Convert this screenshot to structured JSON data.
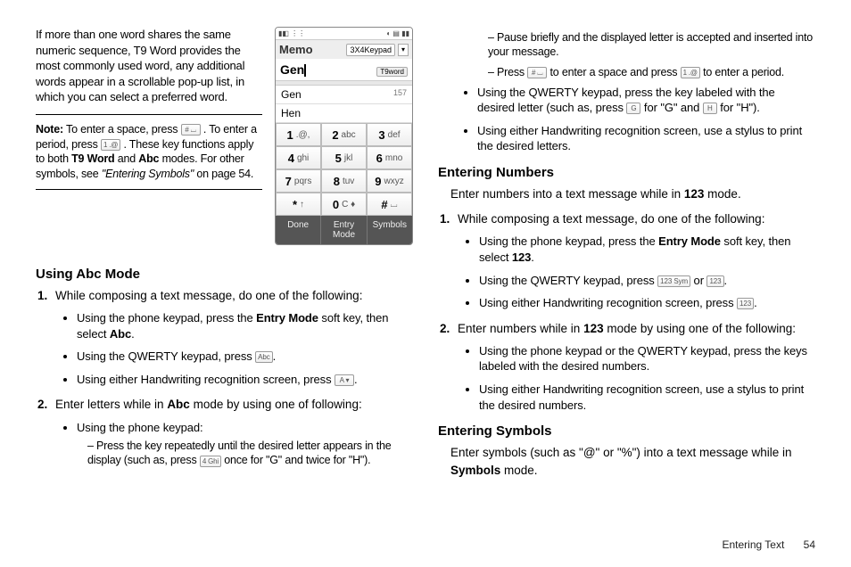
{
  "col1": {
    "intro": "If more than one word shares the same numeric sequence, T9 Word provides the most commonly used word, any additional words appear in a scrollable pop-up list, in which you can select a preferred word.",
    "note": {
      "label": "Note:",
      "p1a": "To enter a space, press ",
      "p1b": ". To enter a period, press ",
      "p1c": ". These key functions apply to both ",
      "b1": "T9 Word",
      "p1d": " and ",
      "b2": "Abc",
      "p1e": " modes. For other symbols, see ",
      "i1": "\"Entering Symbols\"",
      "p1f": " on page 54."
    },
    "h_abc": "Using Abc Mode",
    "abc_1": "While composing a text message, do one of the following:",
    "abc_1_b1a": "Using the phone keypad, press the ",
    "abc_1_b1b": "Entry Mode",
    "abc_1_b1c": " soft key, then select ",
    "abc_1_b1d": "Abc",
    "abc_1_b1e": ".",
    "abc_1_b2a": "Using the QWERTY keypad, press ",
    "abc_1_b2b": ".",
    "abc_1_b3a": "Using either Handwriting recognition screen, press ",
    "abc_1_b3b": ".",
    "abc_2a": "Enter letters while in ",
    "abc_2b": "Abc",
    "abc_2c": " mode by using one of following:",
    "abc_2_b1": "Using the phone keypad:",
    "abc_2_b1_d1a": "Press the key repeatedly until the desired letter appears in the display (such as, press ",
    "abc_2_b1_d1b": " once for \"G\" and twice for \"H\")."
  },
  "phone": {
    "title": "Memo",
    "mode_label": "3X4Keypad",
    "typed": "Gen",
    "badge": "T9word",
    "sugg1": "Gen",
    "sugg1_ct": "157",
    "sugg2": "Hen",
    "keys": [
      {
        "n": "1",
        "l": ".@,"
      },
      {
        "n": "2",
        "l": "abc"
      },
      {
        "n": "3",
        "l": "def"
      },
      {
        "n": "4",
        "l": "ghi"
      },
      {
        "n": "5",
        "l": "jkl"
      },
      {
        "n": "6",
        "l": "mno"
      },
      {
        "n": "7",
        "l": "pqrs"
      },
      {
        "n": "8",
        "l": "tuv"
      },
      {
        "n": "9",
        "l": "wxyz"
      },
      {
        "n": "*",
        "l": "↑"
      },
      {
        "n": "0",
        "l": "C ♦"
      },
      {
        "n": "#",
        "l": "⌴"
      }
    ],
    "sk1": "Done",
    "sk2": "Entry Mode",
    "sk3": "Symbols"
  },
  "col2": {
    "cont_d1": "Pause briefly and the displayed letter is accepted and inserted into your message.",
    "cont_d2a": "Press ",
    "cont_d2b": " to enter a space and press ",
    "cont_d2c": " to enter a period.",
    "cont_b2a": "Using the QWERTY keypad, press the key labeled with the desired letter (such as, press ",
    "cont_b2b": " for \"G\" and ",
    "cont_b2c": " for \"H\").",
    "cont_b3": "Using either Handwriting recognition screen, use a stylus to print the desired letters.",
    "h_num": "Entering Numbers",
    "num_intro_a": "Enter numbers into a text message while in ",
    "num_intro_b": "123",
    "num_intro_c": " mode.",
    "num_1": "While composing a text message, do one of the following:",
    "num_1_b1a": "Using the phone keypad, press the ",
    "num_1_b1b": "Entry Mode",
    "num_1_b1c": " soft key, then select ",
    "num_1_b1d": "123",
    "num_1_b1e": ".",
    "num_1_b2a": "Using the QWERTY keypad, press ",
    "num_1_b2b": " or ",
    "num_1_b2c": ".",
    "num_1_b3a": "Using either Handwriting recognition screen, press ",
    "num_1_b3b": ".",
    "num_2a": "Enter numbers while in ",
    "num_2b": "123",
    "num_2c": " mode by using one of the following:",
    "num_2_b1": "Using the phone keypad or the QWERTY keypad, press the keys labeled with the desired numbers.",
    "num_2_b2": "Using either Handwriting recognition screen, use a stylus to print the desired numbers.",
    "h_sym": "Entering Symbols",
    "sym_intro_a": "Enter symbols (such as \"@\" or \"%\") into a text message while in ",
    "sym_intro_b": "Symbols",
    "sym_intro_c": " mode."
  },
  "footer": {
    "section": "Entering Text",
    "page": "54"
  },
  "icons": {
    "hash_space": "# ⌴",
    "one_at": "1 .@",
    "abc_key": "Abc",
    "a_key": "A ▾",
    "four_ghi": "4 Ghi",
    "g_key": "G",
    "h_key": "H",
    "sym123": "123 Sym",
    "num123": "123",
    "box123": "123"
  }
}
